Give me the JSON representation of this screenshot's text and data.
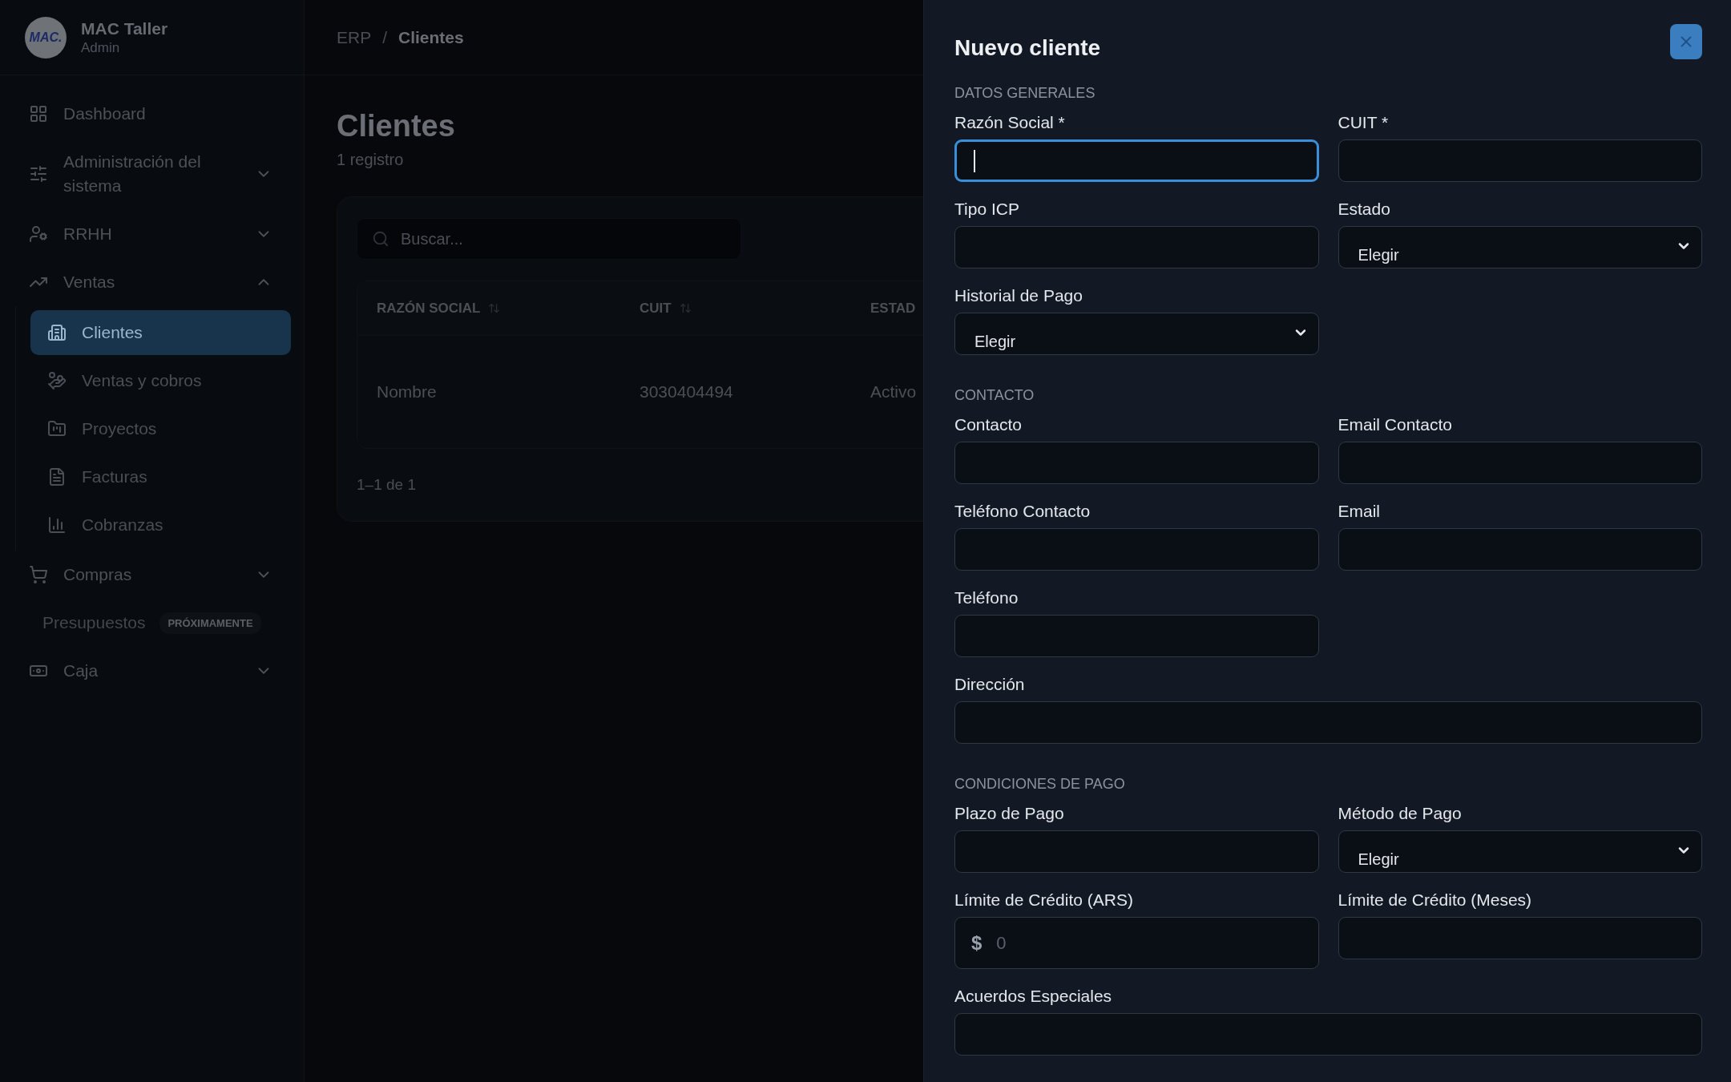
{
  "sidebar": {
    "logo": "MAC.",
    "company": "MAC Taller",
    "role": "Admin",
    "nav": [
      {
        "label": "Dashboard",
        "kind": "link",
        "selected": false
      },
      {
        "label": "Administración del sistema",
        "kind": "group",
        "expanded": false,
        "selected": false
      },
      {
        "label": "RRHH",
        "kind": "group",
        "expanded": false,
        "selected": false
      },
      {
        "label": "Ventas",
        "kind": "group",
        "expanded": true,
        "selected": false,
        "children": [
          {
            "label": "Clientes",
            "selected": true
          },
          {
            "label": "Ventas y cobros",
            "selected": false
          },
          {
            "label": "Proyectos",
            "selected": false
          },
          {
            "label": "Facturas",
            "selected": false
          },
          {
            "label": "Cobranzas",
            "selected": false
          }
        ]
      },
      {
        "label": "Compras",
        "kind": "group",
        "expanded": false,
        "selected": false
      },
      {
        "label": "Presupuestos",
        "kind": "soon",
        "badge": "PRÓXIMAMENTE",
        "selected": false
      },
      {
        "label": "Caja",
        "kind": "group",
        "expanded": false,
        "selected": false
      }
    ]
  },
  "breadcrumb": {
    "items": [
      "ERP",
      "Clientes"
    ],
    "separator": "/"
  },
  "page": {
    "title": "Clientes",
    "subtitle": "1 registro",
    "search": {
      "placeholder": "Buscar..."
    },
    "table": {
      "columns": [
        "RAZÓN SOCIAL",
        "CUIT",
        "ESTAD"
      ],
      "rows": [
        [
          "Nombre",
          "3030404494",
          "Activo"
        ]
      ]
    },
    "pagination": "1–1 de 1"
  },
  "drawer": {
    "title": "Nuevo cliente",
    "sections": [
      {
        "heading": "DATOS GENERALES",
        "fields": [
          {
            "label": "Razón Social *",
            "kind": "text",
            "focused": true
          },
          {
            "label": "CUIT *",
            "kind": "text",
            "focused": false
          },
          {
            "label": "Tipo ICP",
            "kind": "text",
            "focused": false
          },
          {
            "label": "Estado",
            "kind": "select",
            "value": "Elegir",
            "focused": false
          },
          {
            "label": "Historial de Pago",
            "kind": "select",
            "value": "Elegir",
            "focused": false
          }
        ]
      },
      {
        "heading": "CONTACTO",
        "fields": [
          {
            "label": "Contacto",
            "kind": "text",
            "focused": false
          },
          {
            "label": "Email Contacto",
            "kind": "text",
            "focused": false
          },
          {
            "label": "Teléfono Contacto",
            "kind": "text",
            "focused": false
          },
          {
            "label": "Email",
            "kind": "text",
            "focused": false
          },
          {
            "label": "Teléfono",
            "kind": "text",
            "focused": false
          },
          {
            "label": "Dirección",
            "kind": "wide",
            "focused": false
          }
        ]
      },
      {
        "heading": "CONDICIONES DE PAGO",
        "fields": [
          {
            "label": "Plazo de Pago",
            "kind": "text",
            "focused": false
          },
          {
            "label": "Método de Pago",
            "kind": "select",
            "value": "Elegir",
            "focused": false
          },
          {
            "label": "Límite de Crédito (ARS)",
            "kind": "money",
            "prefix": "$",
            "placeholder": "0",
            "focused": false
          },
          {
            "label": "Límite de Crédito (Meses)",
            "kind": "text",
            "focused": false
          },
          {
            "label": "Acuerdos Especiales",
            "kind": "wide",
            "focused": false
          }
        ]
      }
    ]
  }
}
